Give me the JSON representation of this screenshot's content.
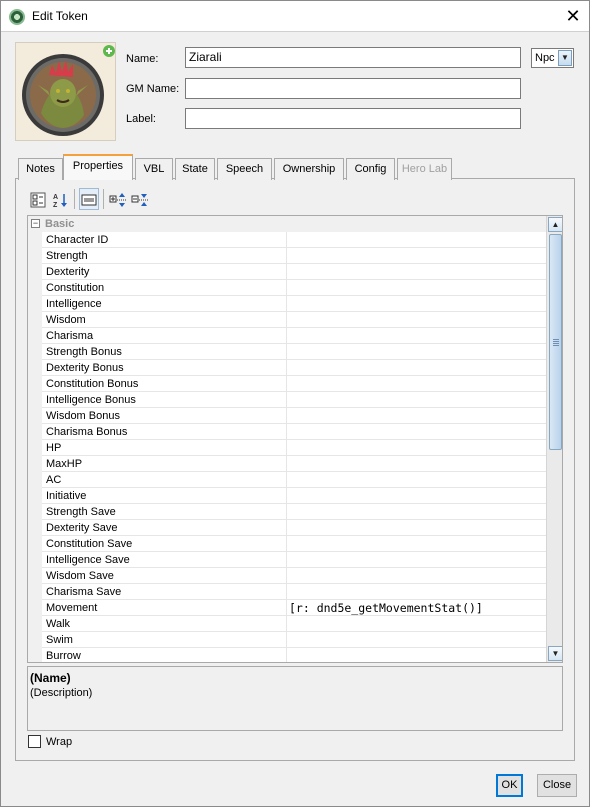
{
  "window": {
    "title": "Edit Token",
    "close_glyph": "✕"
  },
  "header": {
    "name_label": "Name:",
    "name_value": "Ziarali",
    "gm_name_label": "GM Name:",
    "gm_name_value": "",
    "label_label": "Label:",
    "label_value": "",
    "type_select": "Npc",
    "portrait_icon": "goblin-portrait"
  },
  "tabs": [
    {
      "label": "Notes"
    },
    {
      "label": "Properties",
      "active": true
    },
    {
      "label": "VBL"
    },
    {
      "label": "State"
    },
    {
      "label": "Speech"
    },
    {
      "label": "Ownership"
    },
    {
      "label": "Config"
    },
    {
      "label": "Hero Lab",
      "disabled": true
    }
  ],
  "properties": {
    "category": "Basic",
    "toggle_glyph": "−",
    "rows": [
      {
        "name": "Character ID",
        "value": ""
      },
      {
        "name": "Strength",
        "value": ""
      },
      {
        "name": "Dexterity",
        "value": ""
      },
      {
        "name": "Constitution",
        "value": ""
      },
      {
        "name": "Intelligence",
        "value": ""
      },
      {
        "name": "Wisdom",
        "value": ""
      },
      {
        "name": "Charisma",
        "value": ""
      },
      {
        "name": "Strength Bonus",
        "value": ""
      },
      {
        "name": "Dexterity Bonus",
        "value": ""
      },
      {
        "name": "Constitution Bonus",
        "value": ""
      },
      {
        "name": "Intelligence Bonus",
        "value": ""
      },
      {
        "name": "Wisdom Bonus",
        "value": ""
      },
      {
        "name": "Charisma Bonus",
        "value": ""
      },
      {
        "name": "HP",
        "value": ""
      },
      {
        "name": "MaxHP",
        "value": ""
      },
      {
        "name": "AC",
        "value": ""
      },
      {
        "name": "Initiative",
        "value": ""
      },
      {
        "name": "Strength Save",
        "value": ""
      },
      {
        "name": "Dexterity Save",
        "value": ""
      },
      {
        "name": "Constitution Save",
        "value": ""
      },
      {
        "name": "Intelligence Save",
        "value": ""
      },
      {
        "name": "Wisdom Save",
        "value": ""
      },
      {
        "name": "Charisma Save",
        "value": ""
      },
      {
        "name": "Movement",
        "value": "[r: dnd5e_getMovementStat()]"
      },
      {
        "name": "Walk",
        "value": ""
      },
      {
        "name": "Swim",
        "value": ""
      },
      {
        "name": "Burrow",
        "value": ""
      }
    ]
  },
  "description": {
    "name": "(Name)",
    "text": "(Description)"
  },
  "wrap": {
    "label": "Wrap",
    "checked": false
  },
  "buttons": {
    "ok": "OK",
    "close": "Close"
  },
  "colors": {
    "active_tab_accent": "#f3a13d",
    "default_button_border": "#0078d7"
  }
}
